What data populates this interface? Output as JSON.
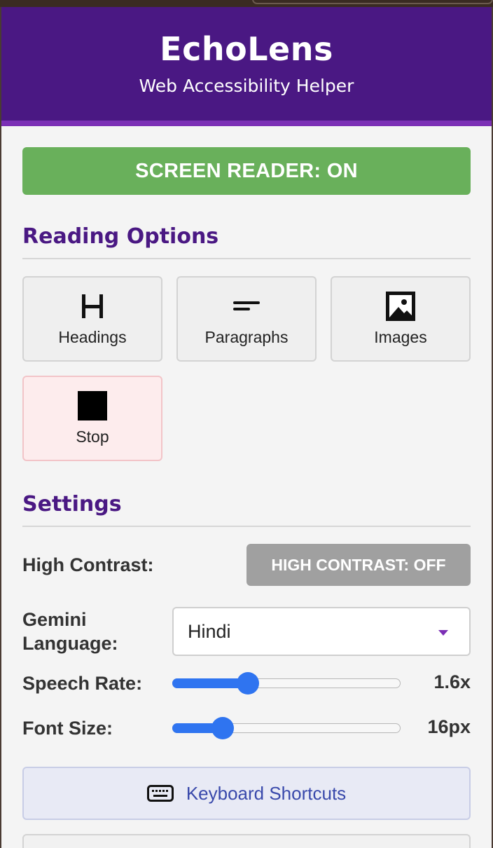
{
  "header": {
    "title": "EchoLens",
    "subtitle": "Web Accessibility Helper"
  },
  "screen_reader": {
    "label": "SCREEN READER: ON",
    "enabled": true,
    "color": "#69b05b"
  },
  "reading_options": {
    "title": "Reading Options",
    "buttons": [
      {
        "label": "Headings",
        "icon": "heading-icon"
      },
      {
        "label": "Paragraphs",
        "icon": "paragraph-icon"
      },
      {
        "label": "Images",
        "icon": "image-icon"
      },
      {
        "label": "Stop",
        "icon": "stop-icon"
      }
    ]
  },
  "settings": {
    "title": "Settings",
    "high_contrast": {
      "label": "High Contrast:",
      "button_label": "HIGH CONTRAST: OFF",
      "enabled": false
    },
    "language": {
      "label": "Gemini Language:",
      "selected": "Hindi"
    },
    "speech_rate": {
      "label": "Speech Rate:",
      "value": 1.6,
      "display": "1.6x",
      "fill_fraction": 0.33
    },
    "font_size": {
      "label": "Font Size:",
      "value": 16,
      "display": "16px",
      "fill_fraction": 0.22
    }
  },
  "keyboard_shortcuts": {
    "label": "Keyboard Shortcuts",
    "icon": "keyboard-icon"
  },
  "colors": {
    "brand": "#4a1883",
    "accent": "#7b2fb5",
    "slider": "#2f74f0",
    "link": "#3949ab"
  }
}
